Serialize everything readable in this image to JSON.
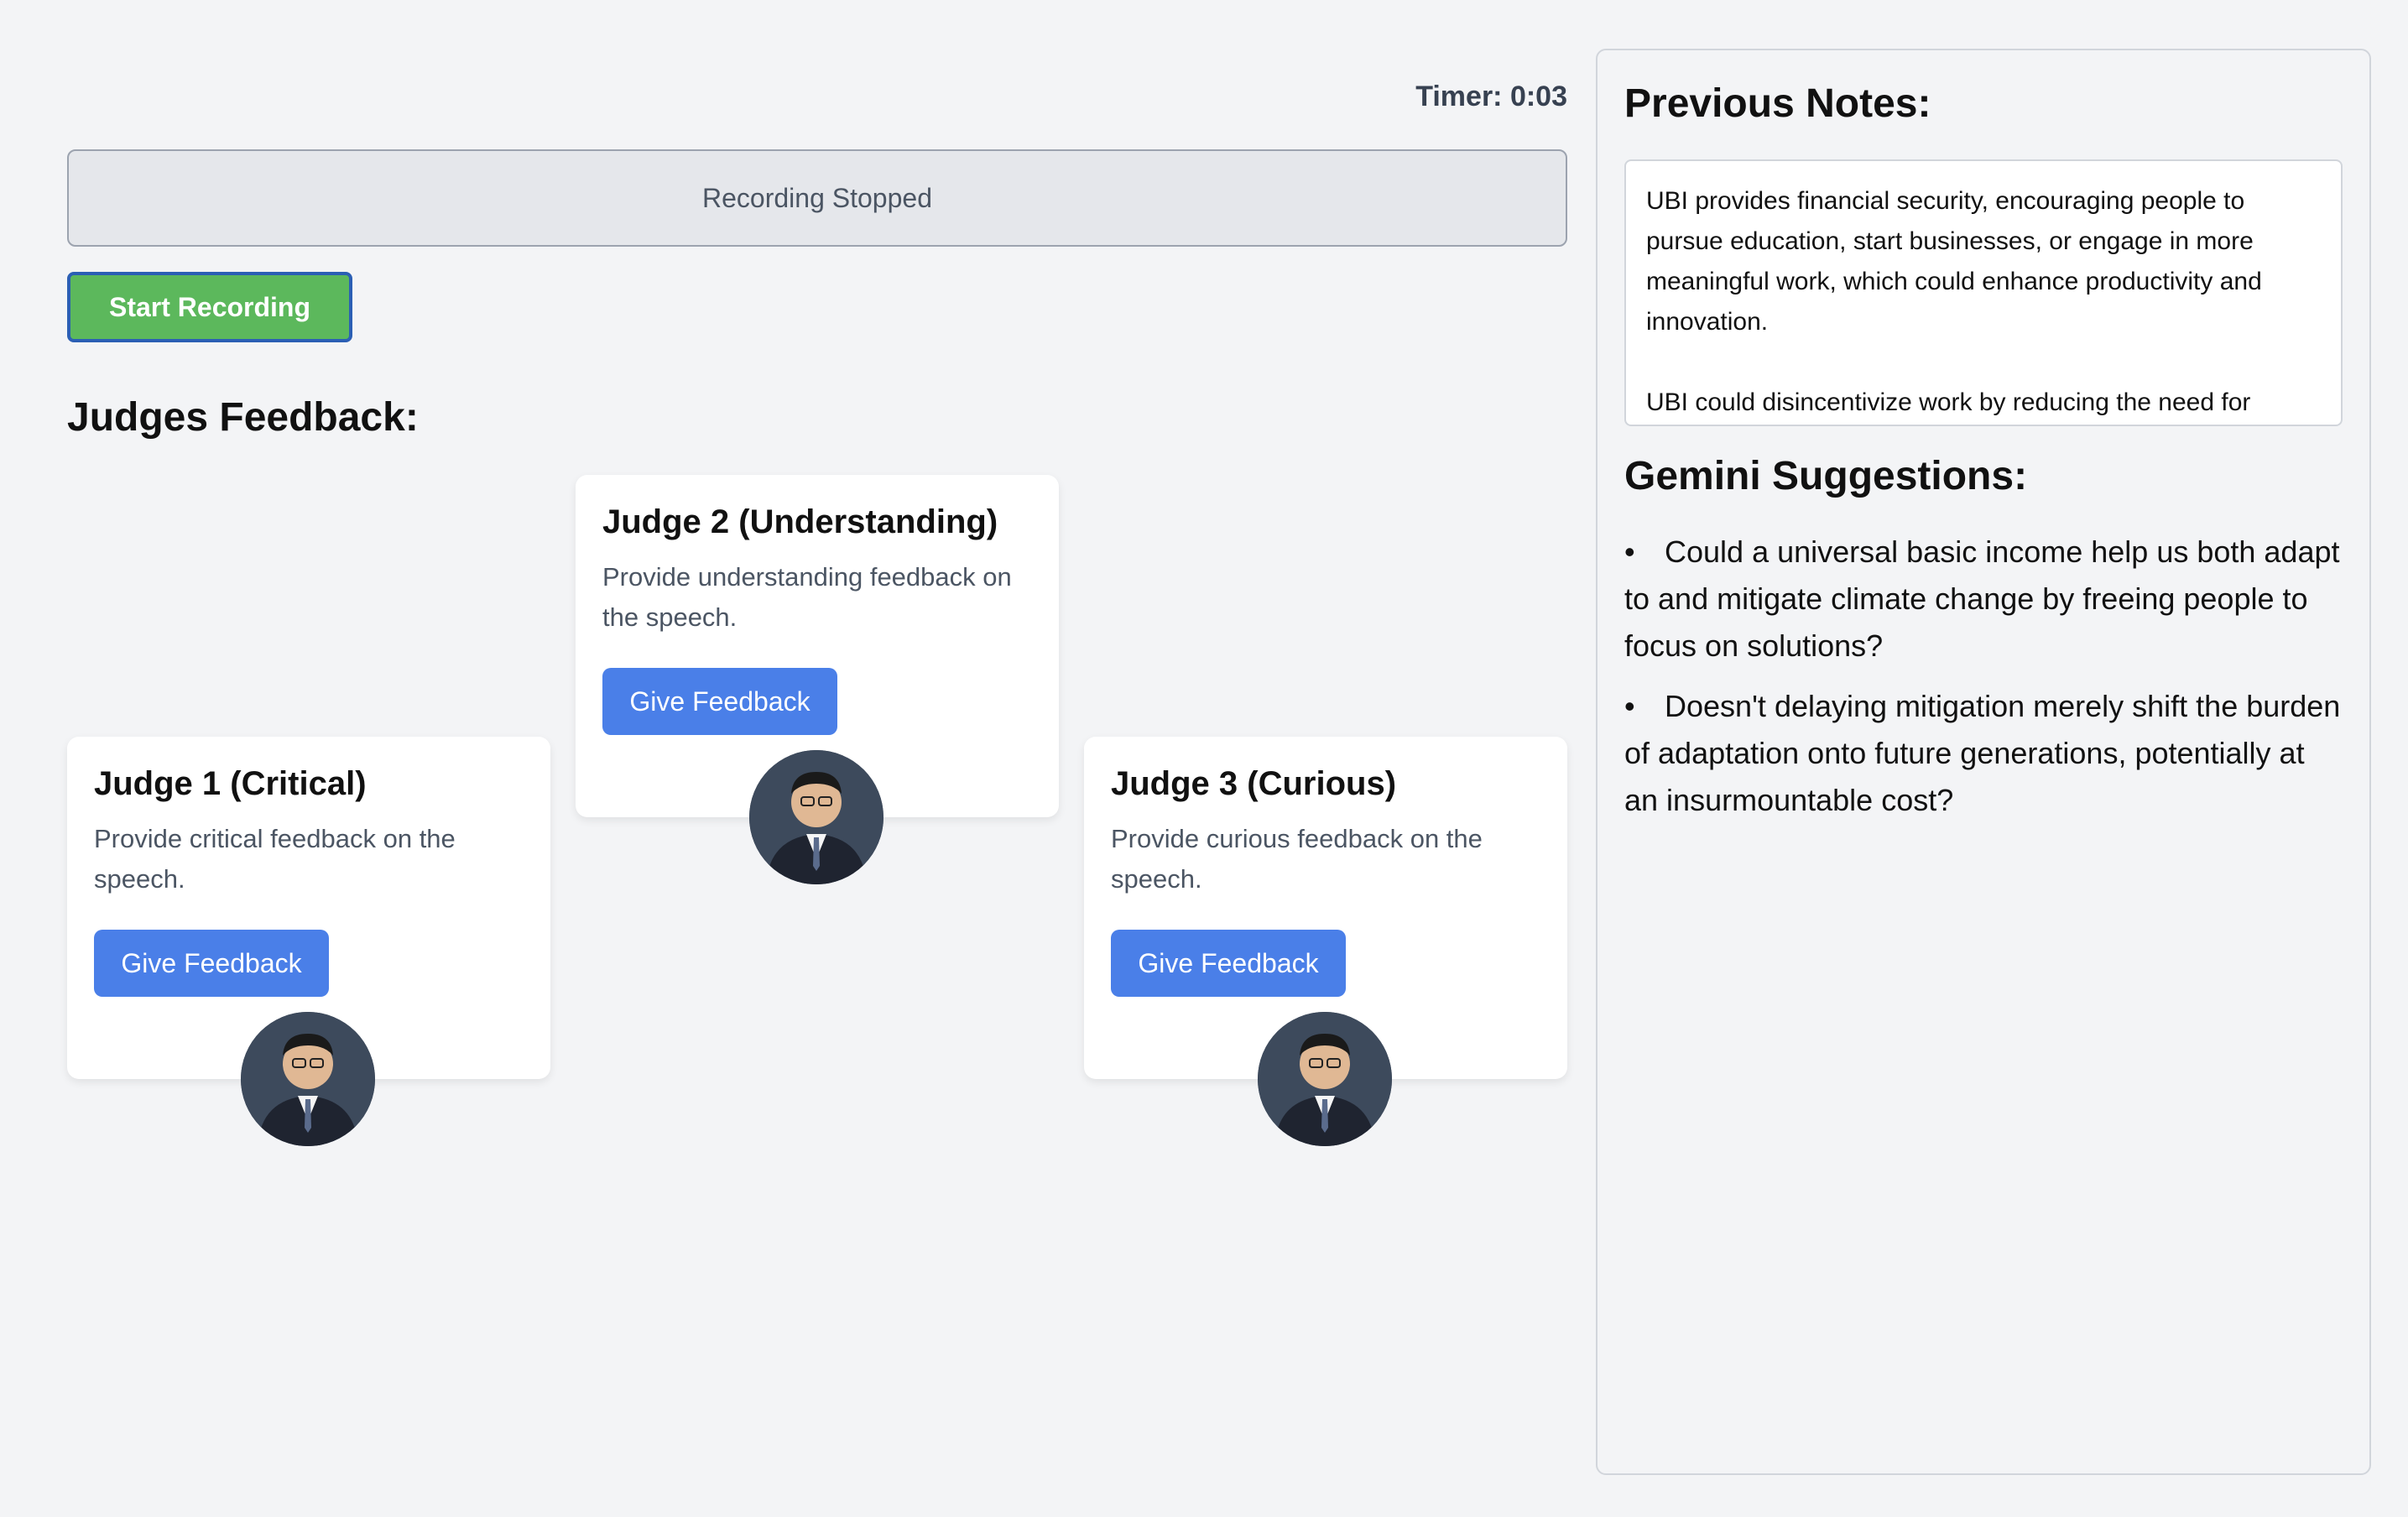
{
  "timer": {
    "label": "Timer:",
    "value": "0:03",
    "display": "Timer: 0:03"
  },
  "status": {
    "text": "Recording Stopped"
  },
  "controls": {
    "record_label": "Start Recording"
  },
  "judges_section": {
    "title": "Judges Feedback:"
  },
  "judges": [
    {
      "title": "Judge 1 (Critical)",
      "description": "Provide critical feedback on the speech.",
      "button_label": "Give Feedback"
    },
    {
      "title": "Judge 2 (Understanding)",
      "description": "Provide understanding feedback on the speech.",
      "button_label": "Give Feedback"
    },
    {
      "title": "Judge 3 (Curious)",
      "description": "Provide curious feedback on the speech.",
      "button_label": "Give Feedback"
    }
  ],
  "sidebar": {
    "notes_title": "Previous Notes:",
    "notes": [
      "UBI provides financial security, encouraging people to pursue education, start businesses, or engage in more meaningful work, which could enhance productivity and innovation.",
      "UBI could disincentivize work by reducing the need for"
    ],
    "suggestions_title": "Gemini Suggestions:",
    "suggestions": [
      "Could a universal basic income help us both adapt to and mitigate climate change by freeing people to focus on solutions?",
      "Doesn't delaying mitigation merely shift the burden of adaptation onto future generations, potentially at an insurmountable cost?"
    ]
  },
  "colors": {
    "record_button": "#5cb85c",
    "feedback_button": "#4a7fe8",
    "background": "#f3f4f6"
  },
  "icons": {
    "judge_avatar": "person-avatar-icon"
  }
}
